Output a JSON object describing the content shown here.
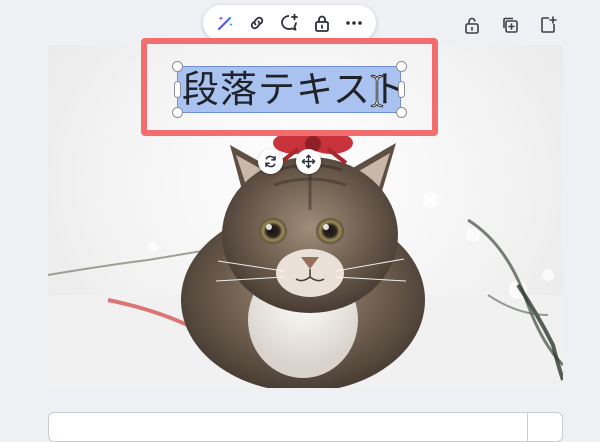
{
  "text_element": {
    "content": "段落テキスト"
  },
  "toolbar": {
    "items": [
      "magic-write",
      "link",
      "comment",
      "lock",
      "more"
    ]
  },
  "right_actions": [
    "unlock",
    "duplicate",
    "add-page"
  ],
  "colors": {
    "highlight": "#f26d6d",
    "selection": "#a9c2ef",
    "accent": "#6f8ed8"
  }
}
